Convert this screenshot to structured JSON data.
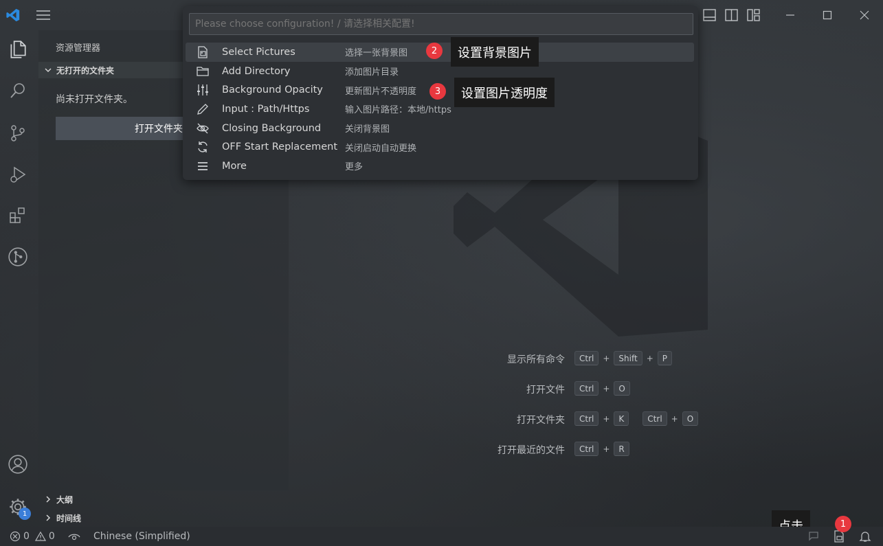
{
  "window": {
    "controls": [
      "minimize",
      "maximize",
      "close"
    ]
  },
  "activity_bar": {
    "items": [
      "files-icon",
      "search-icon",
      "source-control-icon",
      "run-debug-icon",
      "extensions-icon",
      "git-graph-icon"
    ],
    "bottom": [
      "account-icon",
      "settings-gear-icon"
    ],
    "settings_badge": "1"
  },
  "sidebar": {
    "title": "资源管理器",
    "section_header": "无打开的文件夹",
    "empty_message": "尚未打开文件夹。",
    "open_folder_button": "打开文件夹",
    "outline_label": "大纲",
    "timeline_label": "时间线"
  },
  "quick_pick": {
    "placeholder": "Please choose configuration! / 请选择相关配置!",
    "items": [
      {
        "label": "Select Pictures",
        "description": "选择一张背景图",
        "icon": "picture-file-icon",
        "active": true
      },
      {
        "label": "Add Directory",
        "description": "添加图片目录",
        "icon": "folder-icon",
        "active": false
      },
      {
        "label": "Background Opacity",
        "description": "更新图片不透明度",
        "icon": "sliders-icon",
        "active": false
      },
      {
        "label": "Input : Path/Https",
        "description": "输入图片路径：本地/https",
        "icon": "pencil-icon",
        "active": false
      },
      {
        "label": "Closing Background",
        "description": "关闭背景图",
        "icon": "eye-closed-icon",
        "active": false
      },
      {
        "label": "OFF Start Replacement",
        "description": "关闭启动自动更换",
        "icon": "sync-icon",
        "active": false
      },
      {
        "label": "More",
        "description": "更多",
        "icon": "menu-lines-icon",
        "active": false
      }
    ]
  },
  "callouts": [
    {
      "number": "2",
      "text": "设置背景图片"
    },
    {
      "number": "3",
      "text": "设置图片透明度"
    },
    {
      "number": "1",
      "text": "点击"
    }
  ],
  "shortcuts": [
    {
      "label": "显示所有命令",
      "keys": [
        "Ctrl",
        "Shift",
        "P"
      ]
    },
    {
      "label": "打开文件",
      "keys": [
        "Ctrl",
        "O"
      ]
    },
    {
      "label": "打开文件夹",
      "keys": [
        "Ctrl",
        "K"
      ],
      "keys2": [
        "Ctrl",
        "O"
      ]
    },
    {
      "label": "打开最近的文件",
      "keys": [
        "Ctrl",
        "R"
      ]
    }
  ],
  "status_bar": {
    "errors": "0",
    "warnings": "0",
    "language": "Chinese (Simplified)"
  },
  "colors": {
    "accent_badge": "#3b7ed8",
    "callout_badge": "#e8383f"
  }
}
